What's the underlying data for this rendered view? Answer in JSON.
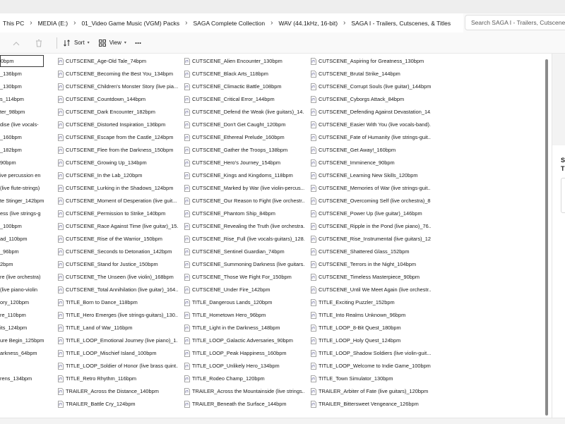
{
  "address": {
    "crumbs": [
      "This PC",
      "MEDIA (E:)",
      "01_Video Game Music (VGM) Packs",
      "SAGA Complete Collection",
      "WAV (44.1kHz, 16-bit)",
      "SAGA I - Trailers, Cutscenes, & Titles"
    ],
    "search_placeholder": "Search SAGA I - Trailers, Cutscenes, & Titles"
  },
  "toolbar": {
    "sort_label": "Sort",
    "view_label": "View",
    "more_label": "···"
  },
  "preview": {
    "title_line1": "SA",
    "title_line2": "Ti"
  },
  "files": {
    "col0": [
      "0bpm",
      "_136bpm",
      "_130bpm",
      "s_114bpm",
      "ter_98bpm",
      "dise (live vocals-",
      "_160bpm",
      "_182bpm",
      "90bpm",
      "ive percussion en",
      "(live flute-strings)",
      "te Stinger_142bpm",
      "ess (live strings-g",
      "_100bpm",
      "ad_110bpm",
      "_96bpm",
      "2bpm",
      "re (live orchestra)",
      "(live piano-violin",
      "ory_120bpm",
      "re_110bpm",
      "its_124bpm",
      "ure Begin_125bpm",
      "arkness_64bpm",
      "",
      "rens_134bpm"
    ],
    "col1": [
      "CUTSCENE_Age-Old Tale_74bpm",
      "CUTSCENE_Becoming the Best You_134bpm",
      "CUTSCENE_Children's Monster Story (live pia...",
      "CUTSCENE_Countdown_144bpm",
      "CUTSCENE_Dark Encounter_182bpm",
      "CUTSCENE_Distorted Inspiration_136bpm",
      "CUTSCENE_Escape from the Castle_124bpm",
      "CUTSCENE_Flee from the Darkness_150bpm",
      "CUTSCENE_Growing Up_134bpm",
      "CUTSCENE_In the Lab_120bpm",
      "CUTSCENE_Lurking in the Shadows_124bpm",
      "CUTSCENE_Moment of Desperation (live guit...",
      "CUTSCENE_Permission to Strike_140bpm",
      "CUTSCENE_Race Against Time (live guitar)_15...",
      "CUTSCENE_Rise of the Warrior_150bpm",
      "CUTSCENE_Seconds to Detonation_142bpm",
      "CUTSCENE_Stand for Justice_150bpm",
      "CUTSCENE_The Unseen (live violin)_168bpm",
      "CUTSCENE_Total Annihilation (live guitar)_164...",
      "TITLE_Born to Dance_118bpm",
      "TITLE_Hero Emerges (live strings-guitars)_130...",
      "TITLE_Land of War_116bpm",
      "TITLE_LOOP_Emotional Journey (live piano)_1...",
      "TITLE_LOOP_Mischief Island_100bpm",
      "TITLE_LOOP_Soldier of Honor (live brass quint...",
      "TITLE_Retro Rhythm_116bpm",
      "TRAILER_Across the Distance_140bpm",
      "TRAILER_Battle Cry_124bpm"
    ],
    "col2": [
      "CUTSCENE_Alien Encounter_130bpm",
      "CUTSCENE_Black Arts_118bpm",
      "CUTSCENE_Climactic Battle_108bpm",
      "CUTSCENE_Critical Error_144bpm",
      "CUTSCENE_Defend the Weak (live guitars)_14...",
      "CUTSCENE_Don't Get Caught_120bpm",
      "CUTSCENE_Ethereal Prelude_160bpm",
      "CUTSCENE_Gather the Troops_138bpm",
      "CUTSCENE_Hero's Journey_154bpm",
      "CUTSCENE_Kings and Kingdoms_118bpm",
      "CUTSCENE_Marked by War (live violin-percus...",
      "CUTSCENE_Our Reason to Fight (live orchestr...",
      "CUTSCENE_Phantom Ship_84bpm",
      "CUTSCENE_Revealing the Truth (live orchestra...",
      "CUTSCENE_Rise_Full (live vocals-guitars)_128...",
      "CUTSCENE_Sentinel Guardian_74bpm",
      "CUTSCENE_Summoning Darkness (live guitars...",
      "CUTSCENE_Those We Fight For_150bpm",
      "CUTSCENE_Under Fire_142bpm",
      "TITLE_Dangerous Lands_120bpm",
      "TITLE_Hometown Hero_96bpm",
      "TITLE_Light in the Darkness_148bpm",
      "TITLE_LOOP_Galactic Adversaries_90bpm",
      "TITLE_LOOP_Peak Happiness_160bpm",
      "TITLE_LOOP_Unlikely Hero_134bpm",
      "TITLE_Rodeo Champ_120bpm",
      "TRAILER_Across the Mountainside (live strings...",
      "TRAILER_Beneath the Surface_144bpm"
    ],
    "col3": [
      "CUTSCENE_Aspiring for Greatness_130bpm",
      "CUTSCENE_Brutal Strike_144bpm",
      "CUTSCENE_Corrupt Souls (live guitar)_144bpm",
      "CUTSCENE_Cyborgs Attack_84bpm",
      "CUTSCENE_Defending Against Devastation_14...",
      "CUTSCENE_Easier With You (live vocals-band)...",
      "CUTSCENE_Fate of Humanity (live strings-guit...",
      "CUTSCENE_Get Away!_160bpm",
      "CUTSCENE_Imminence_90bpm",
      "CUTSCENE_Learning New Skills_120bpm",
      "CUTSCENE_Memories of War (live strings-guit...",
      "CUTSCENE_Overcoming Self (live orchestra)_8...",
      "CUTSCENE_Power Up (live guitar)_146bpm",
      "CUTSCENE_Ripple in the Pond (live piano)_76...",
      "CUTSCENE_Rise_Instrumental (live guitars)_12...",
      "CUTSCENE_Shattered Glass_152bpm",
      "CUTSCENE_Terrors in the Night_104bpm",
      "CUTSCENE_Timeless Masterpiece_90bpm",
      "CUTSCENE_Until We Meet Again (live orchestr...",
      "TITLE_Exciting Puzzler_152bpm",
      "TITLE_Into Realms Unknown_96bpm",
      "TITLE_LOOP_8-Bit Quest_180bpm",
      "TITLE_LOOP_Holy Quest_124bpm",
      "TITLE_LOOP_Shadow Soldiers (live violin-guit...",
      "TITLE_LOOP_Welcome to Indie Game_100bpm",
      "TITLE_Town Simulator_130bpm",
      "TRAILER_Arbiter of Fate (live guitars)_120bpm",
      "TRAILER_Bittersweet Vengeance_126bpm"
    ]
  }
}
